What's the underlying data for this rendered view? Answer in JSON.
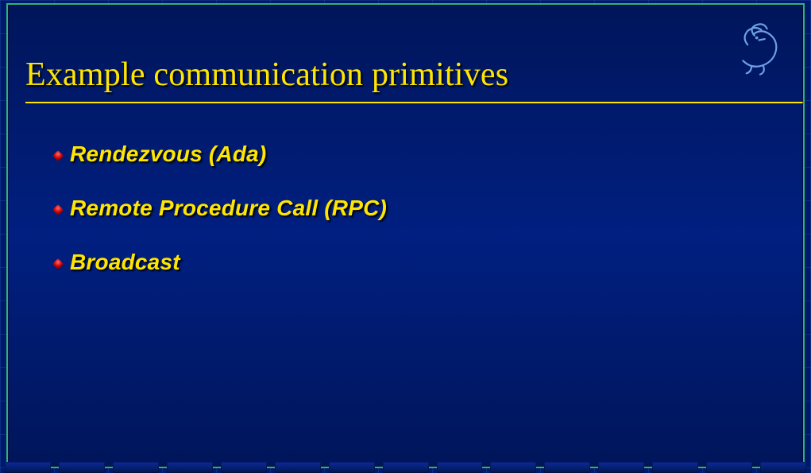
{
  "slide": {
    "title": "Example communication primitives",
    "bullets": [
      {
        "text": "Rendezvous (Ada)"
      },
      {
        "text": "Remote Procedure Call (RPC)"
      },
      {
        "text": "Broadcast"
      }
    ],
    "logo_label": "griffin-logo"
  },
  "theme": {
    "accent": "#ffe600",
    "background": "#001f80",
    "border": "#2fb37a"
  }
}
